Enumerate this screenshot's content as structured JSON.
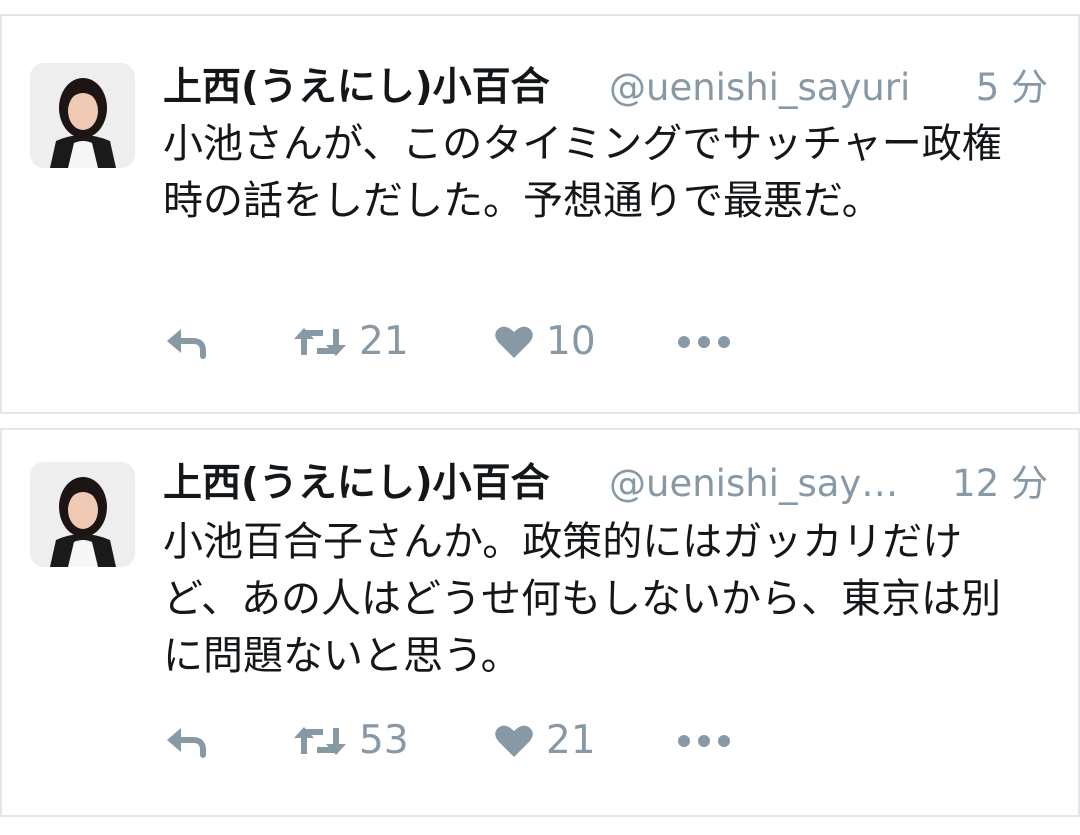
{
  "tweets": [
    {
      "display_name": "上西(うえにし)小百合",
      "handle": "@uenishi_sayuri",
      "time": "5 分",
      "text": "小池さんが、このタイミングでサッチャー政権時の話をしだした。予想通りで最悪だ。",
      "retweets": "21",
      "likes": "10"
    },
    {
      "display_name": "上西(うえにし)小百合",
      "handle": "@uenishi_say…",
      "time": "12 分",
      "text": "小池百合子さんか。政策的にはガッカリだけど、あの人はどうせ何もしないから、東京は別に問題ないと思う。",
      "retweets": "53",
      "likes": "21"
    }
  ],
  "icons": {
    "reply": "reply-icon",
    "retweet": "retweet-icon",
    "like": "heart-icon",
    "more": "more-icon"
  },
  "colors": {
    "text": "#14171a",
    "muted": "#8899a6",
    "divider": "#e1e8ed"
  }
}
